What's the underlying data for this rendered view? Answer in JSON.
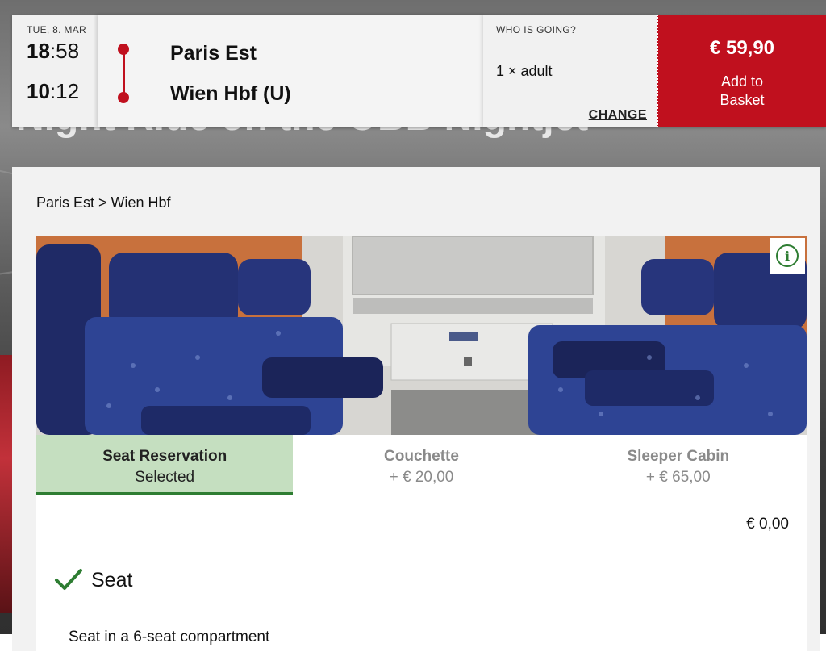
{
  "hero": {
    "title": "Night Ride on the ÖBB Nightjet"
  },
  "journey": {
    "date": "TUE, 8. MAR",
    "departure_hour": "18",
    "departure_min": ":58",
    "arrival_hour": "10",
    "arrival_min": ":12",
    "from": "Paris Est",
    "to": "Wien Hbf (U)"
  },
  "passengers": {
    "label": "WHO IS GOING?",
    "summary": "1 × adult",
    "change_label": "CHANGE"
  },
  "basket": {
    "price": "€ 59,90",
    "add_label_1": "Add to",
    "add_label_2": "Basket"
  },
  "breadcrumb": "Paris Est > Wien Hbf",
  "tabs": [
    {
      "name": "Seat Reservation",
      "sub": "Selected"
    },
    {
      "name": "Couchette",
      "sub": "+ € 20,00"
    },
    {
      "name": "Sleeper Cabin",
      "sub": "+ € 65,00"
    }
  ],
  "selection": {
    "total": "€ 0,00",
    "item": "Seat",
    "description": "Seat in a 6-seat compartment"
  },
  "colors": {
    "brand_red": "#c0101e",
    "selected_green": "#2e7d32",
    "selected_bg": "#c5dfc0"
  },
  "icons": {
    "info": "info-circle-icon",
    "check": "checkmark-icon"
  }
}
